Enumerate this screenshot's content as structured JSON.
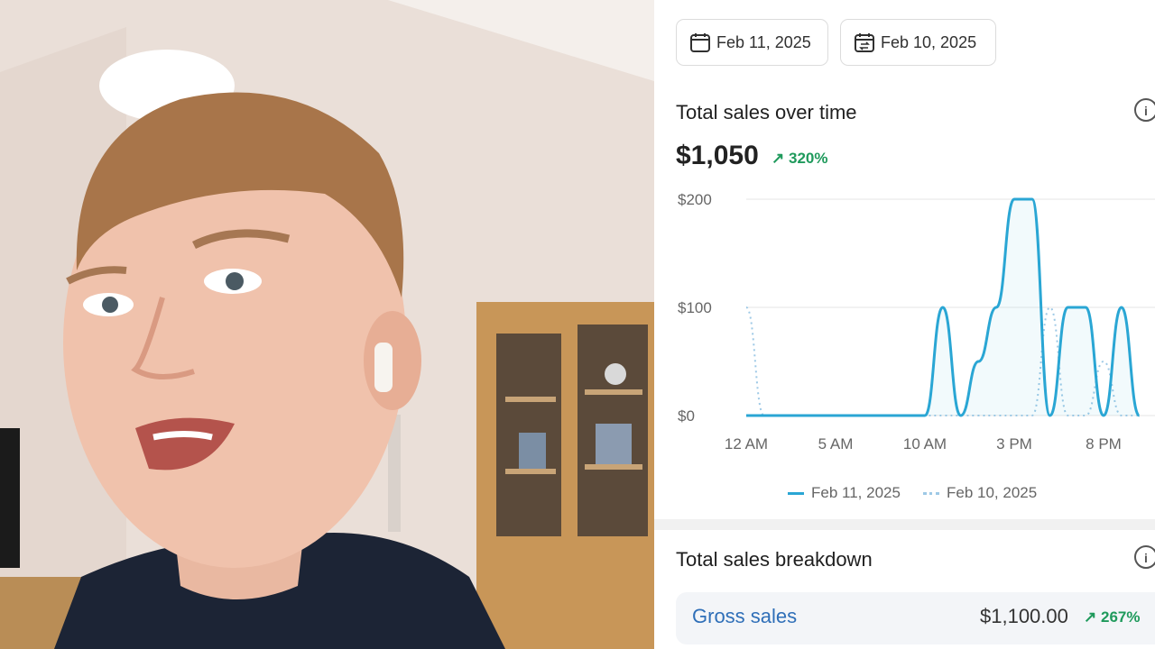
{
  "filters": {
    "date_primary": "Feb 11, 2025",
    "date_compare": "Feb 10, 2025"
  },
  "sales_over_time": {
    "title": "Total sales over time",
    "total": "$1,050",
    "change": "320%",
    "legend": [
      "Feb 11, 2025",
      "Feb 10, 2025"
    ]
  },
  "breakdown": {
    "title": "Total sales breakdown",
    "rows": [
      {
        "label": "Gross sales",
        "value": "$1,100.00",
        "change": "267%"
      }
    ]
  },
  "chart_data": {
    "type": "line",
    "x_ticks": [
      "12 AM",
      "5 AM",
      "10 AM",
      "3 PM",
      "8 PM"
    ],
    "y_ticks": [
      "$0",
      "$100",
      "$200"
    ],
    "ylim": [
      0,
      200
    ],
    "x_hours": [
      0,
      1,
      2,
      3,
      4,
      5,
      6,
      7,
      8,
      9,
      10,
      11,
      12,
      13,
      14,
      15,
      16,
      17,
      18,
      19,
      20,
      21,
      22
    ],
    "series": [
      {
        "name": "Feb 11, 2025",
        "style": "solid",
        "color": "#2aa6d4",
        "values": [
          0,
          0,
          0,
          0,
          0,
          0,
          0,
          0,
          0,
          0,
          0,
          100,
          0,
          50,
          100,
          200,
          200,
          0,
          100,
          100,
          0,
          100,
          0
        ]
      },
      {
        "name": "Feb 10, 2025",
        "style": "dotted",
        "color": "#9ec9e6",
        "values": [
          100,
          0,
          0,
          0,
          0,
          0,
          0,
          0,
          0,
          0,
          0,
          0,
          0,
          0,
          0,
          0,
          0,
          100,
          0,
          0,
          50,
          0,
          0
        ]
      }
    ],
    "grid": true,
    "legend_position": "bottom"
  },
  "colors": {
    "accent": "#2aa6d4",
    "positive": "#1f9a5c",
    "link": "#2f6fb8"
  }
}
